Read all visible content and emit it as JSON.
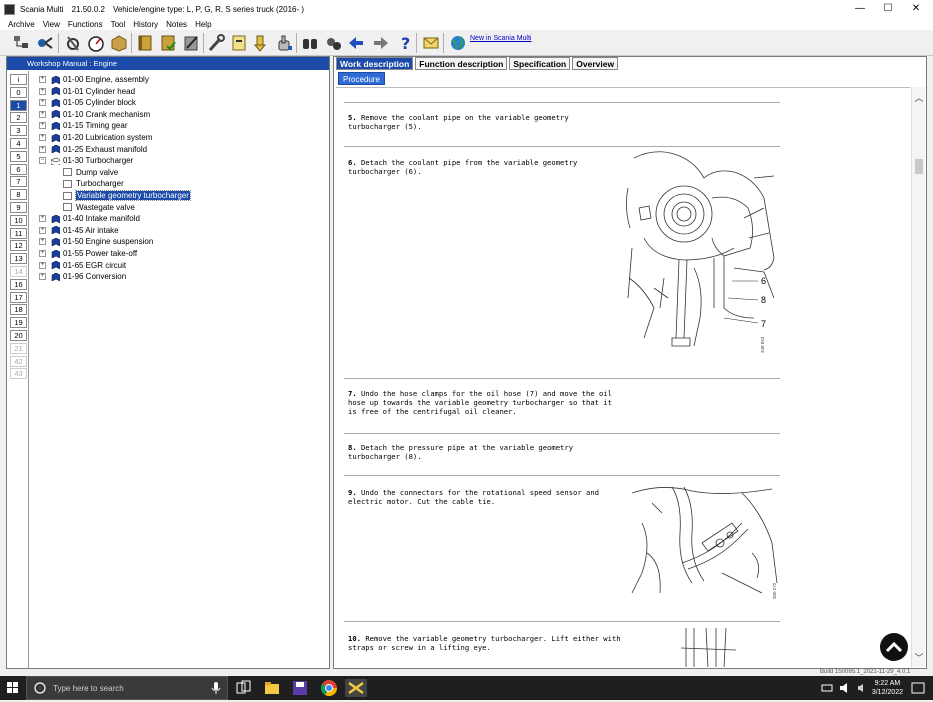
{
  "window": {
    "app_name": "Scania Multi",
    "version": "21.50.0.2",
    "vehicle_type": "Vehicle/engine type: L, P, G, R, S series truck (2016- )",
    "minimize": "—",
    "maximize": "☐",
    "close": "✕"
  },
  "menu": [
    "Archive",
    "View",
    "Functions",
    "Tool",
    "History",
    "Notes",
    "Help"
  ],
  "toolbar": {
    "new_link": "New in Scania Multi",
    "icons": [
      "vehicle-tree-icon",
      "diagnosis-icon",
      "wrench-settings-icon",
      "gauge-icon",
      "parts-box-icon",
      "manual-book-icon",
      "manual-check-icon",
      "edit-manual-icon",
      "tool-icon",
      "notes-icon",
      "bookmark-down-icon",
      "hand-pointer-icon",
      "binoculars-icon",
      "search-parts-icon",
      "back-arrow-icon",
      "forward-arrow-icon",
      "help-icon",
      "mail-icon",
      "globe-icon"
    ]
  },
  "left_panel": {
    "title": "Workshop Manual : Engine",
    "tabs": [
      "i",
      "0",
      "1",
      "2",
      "3",
      "4",
      "5",
      "6",
      "7",
      "8",
      "9",
      "10",
      "11",
      "12",
      "13",
      "14",
      "16",
      "17",
      "18",
      "19",
      "20",
      "21",
      "42",
      "43"
    ],
    "active_tab": "1",
    "dim_tabs": [
      "14",
      "21",
      "42",
      "43"
    ],
    "tree": [
      {
        "label": "01-00 Engine, assembly",
        "level": 0,
        "expander": "+"
      },
      {
        "label": "01-01 Cylinder head",
        "level": 0,
        "expander": "+"
      },
      {
        "label": "01-05 Cylinder block",
        "level": 0,
        "expander": "+"
      },
      {
        "label": "01-10 Crank mechanism",
        "level": 0,
        "expander": "+"
      },
      {
        "label": "01-15 Timing gear",
        "level": 0,
        "expander": "+"
      },
      {
        "label": "01-20 Lubrication system",
        "level": 0,
        "expander": "+"
      },
      {
        "label": "01-25 Exhaust manifold",
        "level": 0,
        "expander": "+"
      },
      {
        "label": "01-30 Turbocharger",
        "level": 0,
        "expander": "−"
      },
      {
        "label": "Dump valve",
        "level": 1,
        "expander": ""
      },
      {
        "label": "Turbocharger",
        "level": 1,
        "expander": ""
      },
      {
        "label": "Variable geometry turbocharger",
        "level": 1,
        "expander": "",
        "selected": true
      },
      {
        "label": "Wastegate valve",
        "level": 1,
        "expander": ""
      },
      {
        "label": "01-40 Intake manifold",
        "level": 0,
        "expander": "+"
      },
      {
        "label": "01-45 Air intake",
        "level": 0,
        "expander": "+"
      },
      {
        "label": "01-50 Engine suspension",
        "level": 0,
        "expander": "+"
      },
      {
        "label": "01-55 Power take-off",
        "level": 0,
        "expander": "+"
      },
      {
        "label": "01-65 EGR circuit",
        "level": 0,
        "expander": "+"
      },
      {
        "label": "01-96 Conversion",
        "level": 0,
        "expander": "+"
      }
    ]
  },
  "right_panel": {
    "tabs": [
      "Work description",
      "Function description",
      "Specification",
      "Overview"
    ],
    "active_tab": "Work description",
    "subtab": "Procedure",
    "steps": [
      {
        "num": "5.",
        "text": "Remove the coolant pipe on the variable geometry\nturbocharger (5)."
      },
      {
        "num": "6.",
        "text": "Detach the coolant pipe from the variable geometry\nturbocharger (6)."
      },
      {
        "num": "7.",
        "text": "Undo the hose clamps for the oil hose (7) and move the oil\nhose up towards the variable geometry turbocharger so that it\nis free of the centrifugal oil cleaner."
      },
      {
        "num": "8.",
        "text": "Detach the pressure pipe at the variable geometry\nturbocharger (8)."
      },
      {
        "num": "9.",
        "text": "Undo the connectors for the rotational speed sensor and\nelectric motor. Cut the cable tie."
      },
      {
        "num": "10.",
        "text": "Remove the variable geometry turbocharger. Lift either with\nstraps or screw in a lifting eye."
      }
    ],
    "figure1": {
      "callouts": [
        "6",
        "8",
        "7"
      ],
      "ref": "348 843"
    },
    "figure2": {
      "ref": "350 272"
    }
  },
  "status_build": "Build 150095.1_2021-11-29_4.0.1",
  "taskbar": {
    "search_placeholder": "Type here to search",
    "time": "9:22 AM",
    "date": "3/12/2022"
  },
  "colors": {
    "accent": "#1b4aa8",
    "link": "#0000cc"
  }
}
